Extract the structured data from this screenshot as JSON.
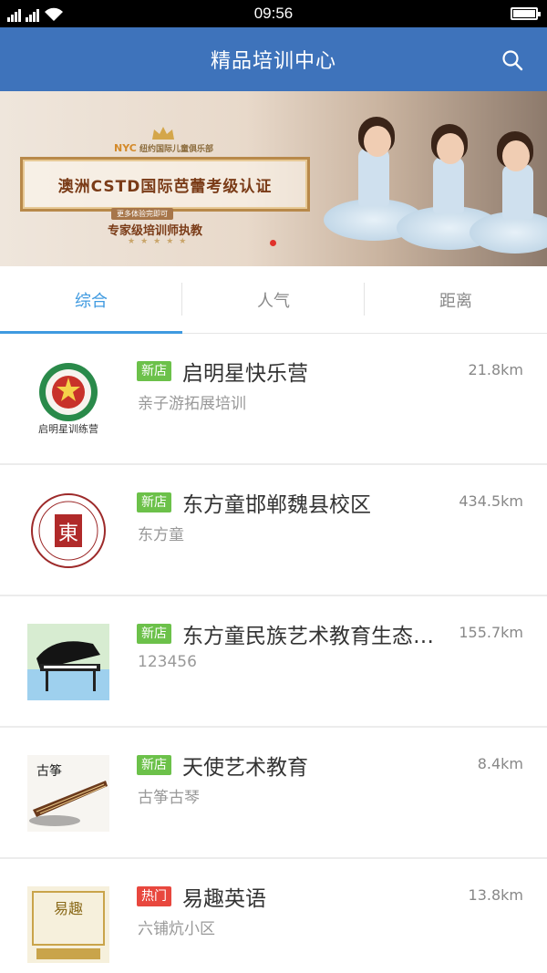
{
  "status_bar": {
    "time": "09:56",
    "sim1_label": "3G",
    "sim2_label": "2G"
  },
  "header": {
    "title": "精品培训中心",
    "search_icon": "search-icon"
  },
  "banner": {
    "brand": "NYC",
    "brand_sub": "纽约国际儿童俱乐部",
    "headline": "澳洲CSTD国际芭蕾考级认证",
    "ribbon": "更多体验完即可",
    "subline": "专家级培训师执教",
    "stars": "★★★★★"
  },
  "tabs": [
    {
      "label": "综合",
      "active": true
    },
    {
      "label": "人气",
      "active": false
    },
    {
      "label": "距离",
      "active": false
    }
  ],
  "listings": [
    {
      "badge": "新店",
      "badge_type": "new",
      "name": "启明星快乐营",
      "distance": "21.8km",
      "category": "亲子游拓展培训",
      "logo_text": "启明星训练营"
    },
    {
      "badge": "新店",
      "badge_type": "new",
      "name": "东方童邯郸魏县校区",
      "distance": "434.5km",
      "category": "东方童",
      "logo_text": "東"
    },
    {
      "badge": "新店",
      "badge_type": "new",
      "name": "东方童民族艺术教育生态…",
      "distance": "155.7km",
      "category": "123456",
      "logo_text": ""
    },
    {
      "badge": "新店",
      "badge_type": "new",
      "name": "天使艺术教育",
      "distance": "8.4km",
      "category": "古筝古琴",
      "logo_text": "古筝"
    },
    {
      "badge": "热门",
      "badge_type": "hot",
      "name": "易趣英语",
      "distance": "13.8km",
      "category": "六铺炕小区",
      "logo_text": "易趣"
    }
  ],
  "colors": {
    "appbar": "#3e73bb",
    "tab_active": "#3f9ae0",
    "badge_new": "#6cc14a",
    "badge_hot": "#e8473e"
  }
}
